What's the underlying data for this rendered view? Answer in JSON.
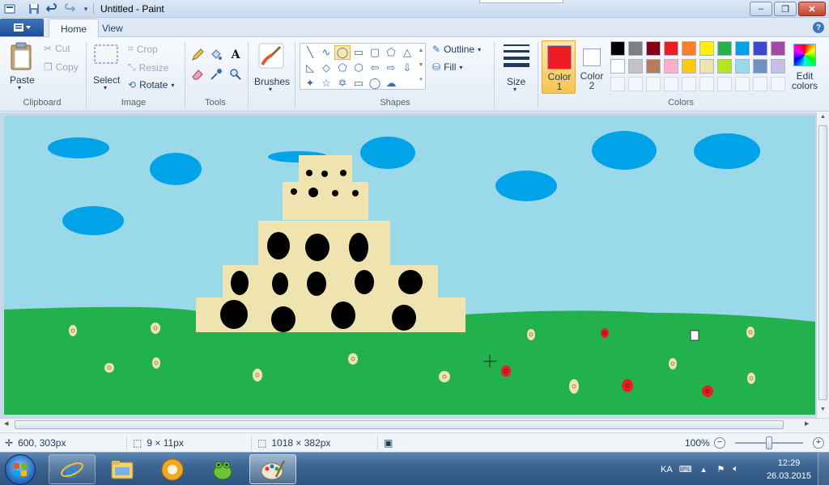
{
  "window": {
    "title": "Untitled - Paint",
    "minimize_label": "‒",
    "maximize_label": "❐",
    "close_label": "✕"
  },
  "quick_access": {
    "save_icon": "save-icon",
    "undo_icon": "undo-icon",
    "redo_icon": "redo-icon",
    "customize_icon": "dropdown-icon"
  },
  "tabs": [
    {
      "label": "Home",
      "active": true
    },
    {
      "label": "View",
      "active": false
    }
  ],
  "help_label": "?",
  "ribbon": {
    "clipboard": {
      "group_label": "Clipboard",
      "paste_label": "Paste",
      "cut_label": "Cut",
      "copy_label": "Copy"
    },
    "image": {
      "group_label": "Image",
      "select_label": "Select",
      "crop_label": "Crop",
      "resize_label": "Resize",
      "rotate_label": "Rotate"
    },
    "tools": {
      "group_label": "Tools",
      "items": [
        "pencil-icon",
        "fill-icon",
        "text-icon",
        "eraser-icon",
        "color-picker-icon",
        "magnifier-icon"
      ],
      "text_tool_label": "A"
    },
    "brushes": {
      "label": "Brushes"
    },
    "shapes": {
      "group_label": "Shapes",
      "outline_label": "Outline",
      "fill_label": "Fill",
      "selected_shape": "oval",
      "items": [
        "line",
        "curve",
        "oval",
        "rectangle",
        "rounded-rectangle",
        "polygon",
        "triangle",
        "right-triangle",
        "diamond",
        "pentagon",
        "hexagon",
        "left-arrow",
        "right-arrow",
        "down-arrow",
        "four-point-star",
        "five-point-star",
        "six-point-star",
        "rounded-callout",
        "oval-callout",
        "cloud-callout"
      ],
      "glyphs": [
        "╲",
        "∿",
        "◯",
        "▭",
        "▢",
        "⬠",
        "△",
        "◺",
        "◇",
        "⬠",
        "⬡",
        "⇦",
        "⇨",
        "⇩",
        "✦",
        "☆",
        "✡",
        "▭",
        "◯",
        "☁"
      ]
    },
    "size": {
      "label": "Size"
    },
    "colors": {
      "group_label": "Colors",
      "color1_label": "Color 1",
      "color2_label": "Color 2",
      "color1_line1": "Color",
      "color1_line2": "1",
      "color2_line1": "Color",
      "color2_line2": "2",
      "color1_value": "#ed1c24",
      "color2_value": "#ffffff",
      "edit_line1": "Edit",
      "edit_line2": "colors",
      "palette_row1": [
        "#000000",
        "#7f7f7f",
        "#880015",
        "#ed1c24",
        "#ff7f27",
        "#fff200",
        "#22b14c",
        "#00a2e8",
        "#3f48cc",
        "#a349a4"
      ],
      "palette_row2": [
        "#ffffff",
        "#c3c3c3",
        "#b97a57",
        "#ffaec9",
        "#ffc90e",
        "#efe4b0",
        "#b5e61d",
        "#99d9ea",
        "#7092be",
        "#c8bfe7"
      ]
    }
  },
  "canvas": {
    "sky_color": "#99d9ea",
    "grass_color": "#22b14c",
    "cloud_color": "#00a2e8",
    "cake_color": "#efe4b0",
    "dot_color": "#000000",
    "flower_red": "#ed1c24",
    "flower_cream": "#efe4b0"
  },
  "status": {
    "cursor_position": "600, 303px",
    "selection_size": "9 × 11px",
    "image_size": "1018 × 382px",
    "zoom": "100%",
    "zoom_level": 0.5
  },
  "taskbar": {
    "items": [
      "internet-explorer-icon",
      "file-explorer-icon",
      "media-player-icon",
      "frog-app-icon",
      "paint-icon"
    ],
    "tray_language": "KA",
    "time": "12:29",
    "date": "26.03.2015"
  }
}
